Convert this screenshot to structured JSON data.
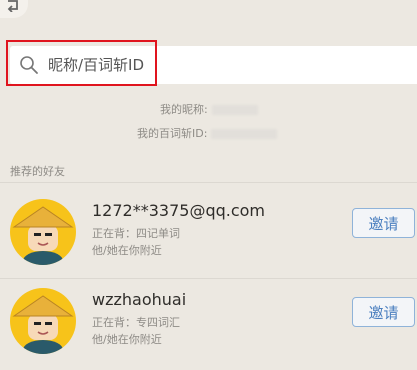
{
  "search": {
    "placeholder": "昵称/百词斩ID"
  },
  "profile": {
    "nickname_label": "我的昵称:",
    "id_label": "我的百词斩ID:"
  },
  "recommended": {
    "title": "推荐的好友",
    "friends": [
      {
        "name": "1272**3375@qq.com",
        "status": "正在背：四记单词",
        "nearby": "他/她在你附近",
        "invite_label": "邀请"
      },
      {
        "name": "wzzhaohuai",
        "status": "正在背：专四词汇",
        "nearby": "他/她在你附近",
        "invite_label": "邀请"
      }
    ]
  },
  "colors": {
    "background": "#ece8e1",
    "highlight_border": "#e0141e",
    "invite_text": "#4b7fbf",
    "avatar_bg": "#f7c31a"
  }
}
